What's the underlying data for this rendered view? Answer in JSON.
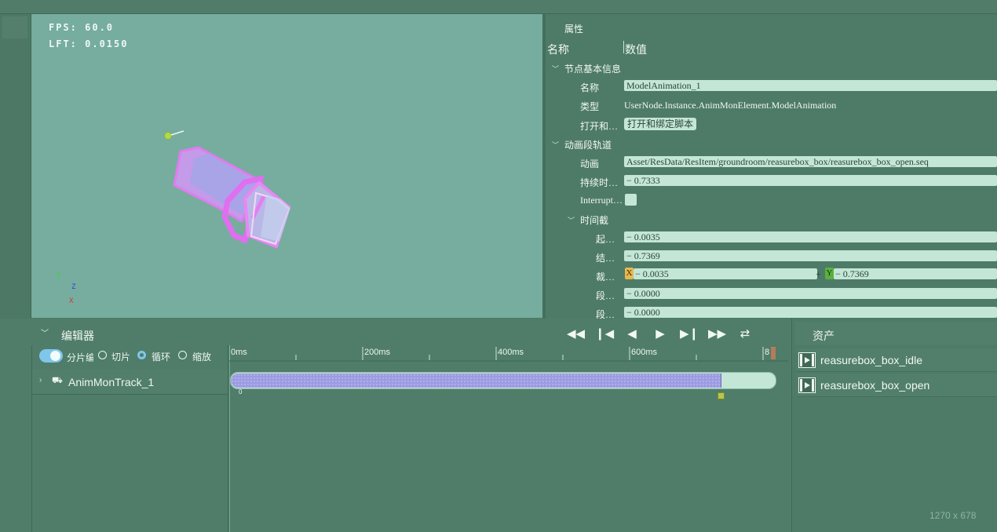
{
  "viewport": {
    "fps": "FPS: 60.0",
    "lft": "LFT: 0.0150",
    "axes": {
      "y": "Y",
      "z": "Z",
      "x": "X"
    }
  },
  "properties": {
    "title": "属性",
    "col_name": "名称",
    "col_value": "数值",
    "section_basic": "节点基本信息",
    "name_label": "名称",
    "name_value": "ModelAnimation_1",
    "type_label": "类型",
    "type_value": "UserNode.Instance.AnimMonElement.ModelAnimation",
    "open_label": "打开和…",
    "open_button": "打开和绑定脚本",
    "section_track": "动画段轨道",
    "anim_label": "动画",
    "anim_value": "Asset/ResData/ResItem/groundroom/reasurebox_box/reasurebox_box_open.seq",
    "duration_label": "持续时…",
    "duration_value": "− 0.7333",
    "interrupt_label": "Interrupt…",
    "section_time": "时间截",
    "start_label": "起…",
    "start_value": "− 0.0035",
    "end_label": "结…",
    "end_value": "− 0.7369",
    "clip_label": "裁…",
    "clip_x_tag": "X",
    "clip_x_value": "− 0.0035",
    "clip_plus": "+",
    "clip_y_tag": "Y",
    "clip_y_value": "− 0.7369",
    "seg1_label": "段…",
    "seg1_value": "− 0.0000",
    "seg2_label": "段…",
    "seg2_value": "− 0.0000"
  },
  "editor": {
    "title": "编辑器",
    "toggle_label": "分片编",
    "opt_slice": "切片",
    "opt_loop": "循环",
    "opt_scale": "缩放",
    "track_name": "AnimMonTrack_1",
    "clip_zero": "0",
    "ticks": [
      "0ms",
      "200ms",
      "400ms",
      "600ms",
      "8"
    ]
  },
  "assets": {
    "title": "资产",
    "items": [
      "reasurebox_box_idle",
      "reasurebox_box_open"
    ]
  },
  "size_label": "1270 x 678",
  "colors": {
    "accent": "#7fc6ea",
    "clip_fill": "#9d9be0",
    "viewport_bg": "#76ad9f",
    "panel_bg": "#4f7d69",
    "field_bg": "#c4e6d7"
  }
}
